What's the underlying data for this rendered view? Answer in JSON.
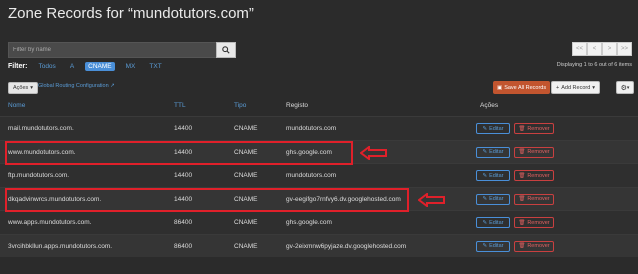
{
  "page": {
    "title": "Zone Records for “mundotutors.com”"
  },
  "search": {
    "placeholder": "Filter by name"
  },
  "filter": {
    "label": "Filter:",
    "options": [
      "Todos",
      "A",
      "CNAME",
      "MX",
      "TXT"
    ],
    "active": "CNAME"
  },
  "pager": {
    "buttons": [
      "<<",
      "<",
      ">",
      ">>"
    ]
  },
  "display_info": "Displaying 1 to 6 out of 6 items",
  "toolbar": {
    "acoes_label": "Ações",
    "global_routing": "Global Routing Configuration",
    "save_all": "Save All Records",
    "add_record": "Add Record"
  },
  "table": {
    "headers": {
      "nome": "Nome",
      "ttl": "TTL",
      "tipo": "Tipo",
      "registo": "Registo",
      "acoes": "Ações"
    },
    "rows": [
      {
        "nome": "mail.mundotutors.com.",
        "ttl": "14400",
        "tipo": "CNAME",
        "registo": "mundotutors.com"
      },
      {
        "nome": "www.mundotutors.com.",
        "ttl": "14400",
        "tipo": "CNAME",
        "registo": "ghs.google.com"
      },
      {
        "nome": "ftp.mundotutors.com.",
        "ttl": "14400",
        "tipo": "CNAME",
        "registo": "mundotutors.com"
      },
      {
        "nome": "dkqadvinwrcs.mundotutors.com.",
        "ttl": "14400",
        "tipo": "CNAME",
        "registo": "gv-eegifgo7rnfvy6.dv.googlehosted.com"
      },
      {
        "nome": "www.apps.mundotutors.com.",
        "ttl": "86400",
        "tipo": "CNAME",
        "registo": "ghs.google.com"
      },
      {
        "nome": "3vrcihbkllun.apps.mundotutors.com.",
        "ttl": "86400",
        "tipo": "CNAME",
        "registo": "gv-2eixmnw6pyjaze.dv.googlehosted.com"
      }
    ],
    "edit_label": "Editar",
    "remove_label": "Remover"
  },
  "colors": {
    "header_text": "#5a9bd5",
    "highlight": "#e0202a",
    "save_btn": "#c2552f"
  }
}
